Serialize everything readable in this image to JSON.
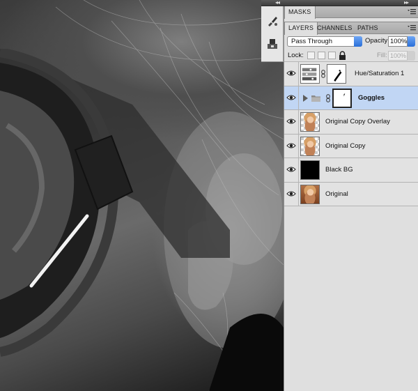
{
  "dock": {
    "collapse_arrows_left": "◂◂",
    "collapse_arrows_right": "▸▸"
  },
  "masks_panel": {
    "tab_label": "MASKS"
  },
  "layers_panel": {
    "tabs": [
      {
        "label": "LAYERS",
        "active": true
      },
      {
        "label": "CHANNELS",
        "active": false
      },
      {
        "label": "PATHS",
        "active": false
      }
    ],
    "blend_mode": "Pass Through",
    "opacity_label": "Opacity:",
    "opacity_value": "100%",
    "lock_label": "Lock:",
    "fill_label": "Fill:",
    "fill_value": "100%",
    "layers": [
      {
        "name": "Hue/Saturation 1",
        "visible": true,
        "type": "adjustment",
        "bold": false,
        "selected": false
      },
      {
        "name": "Goggles",
        "visible": true,
        "type": "group",
        "bold": true,
        "selected": true
      },
      {
        "name": "Original Copy Overlay",
        "visible": true,
        "type": "pixel-transparent",
        "bold": false,
        "selected": false
      },
      {
        "name": "Original Copy",
        "visible": true,
        "type": "pixel-transparent",
        "bold": false,
        "selected": false
      },
      {
        "name": "Black BG",
        "visible": true,
        "type": "fill-black",
        "bold": false,
        "selected": false
      },
      {
        "name": "Original",
        "visible": true,
        "type": "pixel",
        "bold": false,
        "selected": false
      }
    ]
  },
  "colors": {
    "selected_row": "#c1d6f4",
    "panel_bg": "#dfdfdf",
    "accent_blue": "#2a6fd8"
  }
}
